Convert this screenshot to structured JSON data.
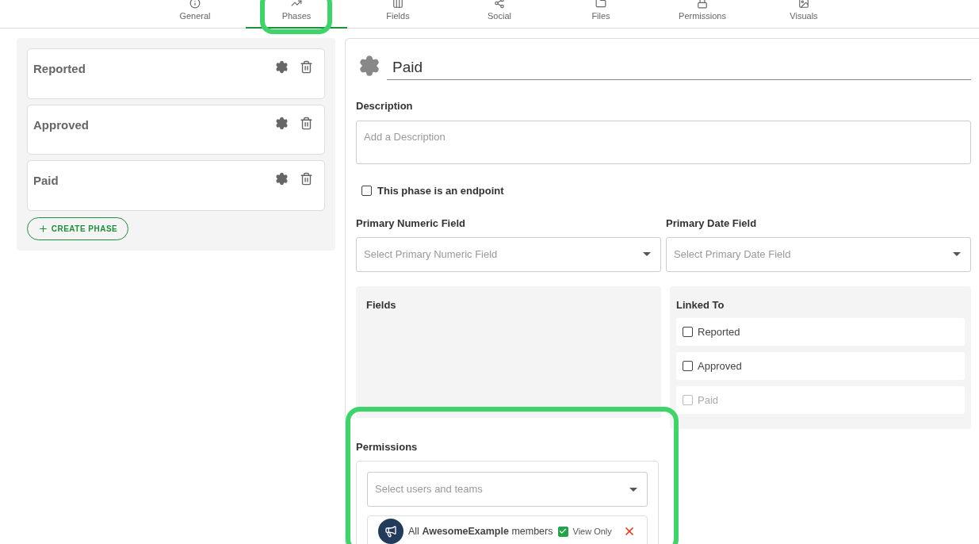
{
  "tabs": [
    {
      "label": "General",
      "selected": false
    },
    {
      "label": "Phases",
      "selected": true
    },
    {
      "label": "Fields",
      "selected": false
    },
    {
      "label": "Social",
      "selected": false
    },
    {
      "label": "Files",
      "selected": false
    },
    {
      "label": "Permissions",
      "selected": false
    },
    {
      "label": "Visuals",
      "selected": false
    }
  ],
  "phases": [
    {
      "name": "Reported"
    },
    {
      "name": "Approved"
    },
    {
      "name": "Paid"
    }
  ],
  "create_button": "CREATE PHASE",
  "editor": {
    "title": "Paid",
    "description": {
      "label": "Description",
      "placeholder": "Add a Description"
    },
    "endpoint": {
      "label": "This phase is an endpoint",
      "checked": false
    },
    "numeric_field": {
      "label": "Primary Numeric Field",
      "placeholder": "Select Primary Numeric Field"
    },
    "date_field": {
      "label": "Primary Date Field",
      "placeholder": "Select Primary Date Field"
    },
    "fields_panel": {
      "title": "Fields"
    },
    "linked_to": {
      "title": "Linked To",
      "items": [
        {
          "label": "Reported",
          "checked": false,
          "disabled": false
        },
        {
          "label": "Approved",
          "checked": false,
          "disabled": false
        },
        {
          "label": "Paid",
          "checked": false,
          "disabled": true
        }
      ]
    },
    "permissions": {
      "title": "Permissions",
      "placeholder": "Select users and teams",
      "members": [
        {
          "text": "All **AwesomeExample** members",
          "view_only": {
            "label": "View Only",
            "checked": true
          }
        }
      ]
    }
  }
}
